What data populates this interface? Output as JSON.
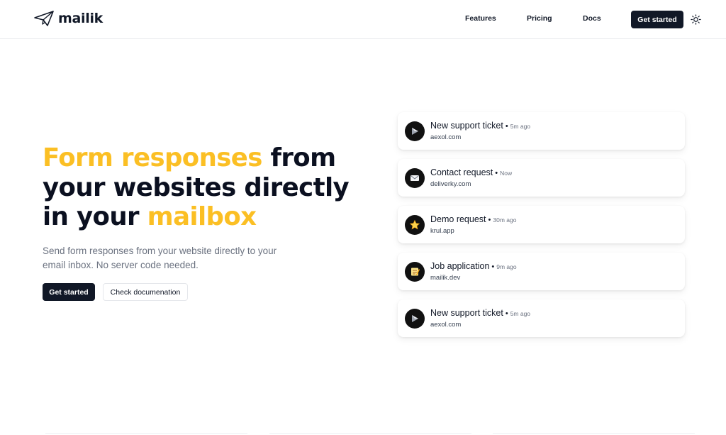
{
  "header": {
    "brand": "mailik",
    "nav": [
      "Features",
      "Pricing",
      "Docs"
    ],
    "cta_label": "Get started",
    "theme_icon": "sun-icon"
  },
  "hero": {
    "title_part1": "Form responses",
    "title_part2": " from your websites directly in your ",
    "title_part3": "mailbox",
    "subtitle": "Send form responses from your website directly to your email inbox. No server code needed.",
    "primary_cta": "Get started",
    "secondary_cta": "Check documenation"
  },
  "notifications": [
    {
      "title": "New support ticket",
      "time": "5m ago",
      "domain": "aexol.com",
      "icon": "play-flag-icon"
    },
    {
      "title": "Contact request",
      "time": "Now",
      "domain": "deliverky.com",
      "icon": "envelope-icon"
    },
    {
      "title": "Demo request",
      "time": "30m ago",
      "domain": "krul.app",
      "icon": "star-icon"
    },
    {
      "title": "Job application",
      "time": "9m ago",
      "domain": "mailik.dev",
      "icon": "memo-icon"
    },
    {
      "title": "New support ticket",
      "time": "5m ago",
      "domain": "aexol.com",
      "icon": "play-flag-icon"
    }
  ],
  "colors": {
    "accent": "#fbbf24",
    "dark": "#111827",
    "muted": "#6b7280"
  }
}
